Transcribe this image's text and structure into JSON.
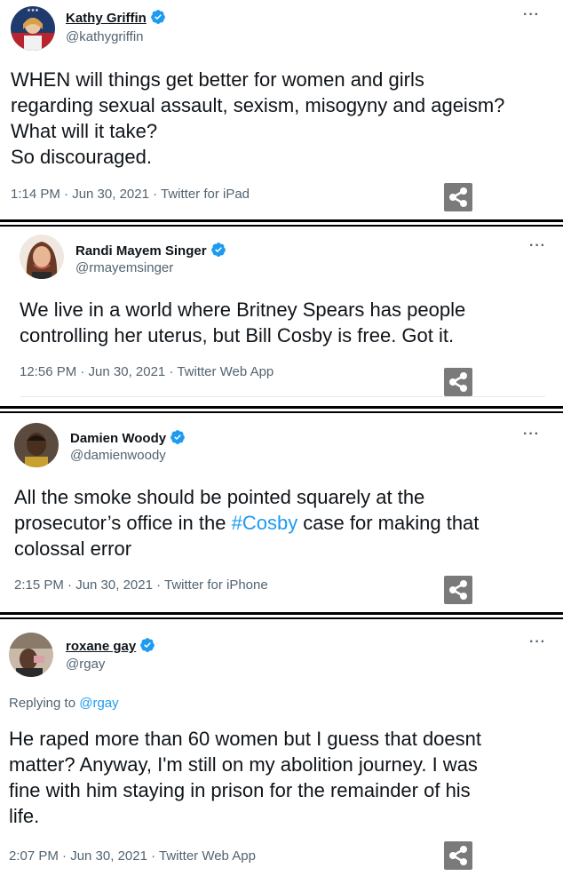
{
  "tweets": [
    {
      "name": "Kathy Griffin",
      "handle": "@kathygriffin",
      "body_lines": [
        "WHEN will things get better for women and girls",
        "regarding sexual assault, sexism, misogyny and ageism?",
        "What will it take?",
        "So discouraged."
      ],
      "meta": "1:14 PM · Jun 30, 2021 · Twitter for iPad"
    },
    {
      "name": "Randi Mayem Singer",
      "handle": "@rmayemsinger",
      "body_lines": [
        "We live in a world where Britney Spears has people",
        "controlling her uterus, but Bill Cosby is free. Got it."
      ],
      "meta": "12:56 PM · Jun 30, 2021 · Twitter Web App"
    },
    {
      "name": "Damien Woody",
      "handle": "@damienwoody",
      "body_line1": "All the smoke should be pointed squarely at the",
      "body_line2_pre": "prosecutor’s office in the ",
      "body_line2_tag": "#Cosby",
      "body_line2_post": " case for making that",
      "body_line3": "colossal error",
      "meta": "2:15 PM · Jun 30, 2021 · Twitter for iPhone"
    },
    {
      "name": "roxane gay",
      "handle": "@rgay",
      "reply_prefix": "Replying to ",
      "reply_mention": "@rgay",
      "body_lines": [
        "He raped more than 60 women but I guess that doesnt",
        "matter? Anyway, I'm still on my abolition journey. I was",
        "fine with him staying in prison for the remainder of his",
        "life."
      ],
      "meta": "2:07 PM · Jun 30, 2021 · Twitter Web App"
    }
  ],
  "icons": {
    "more": "···",
    "verified": "verified-badge-icon",
    "share": "share-icon"
  },
  "colors": {
    "link": "#1d9bf0",
    "secondary": "#536471",
    "share_bg": "#7a7a7a"
  }
}
